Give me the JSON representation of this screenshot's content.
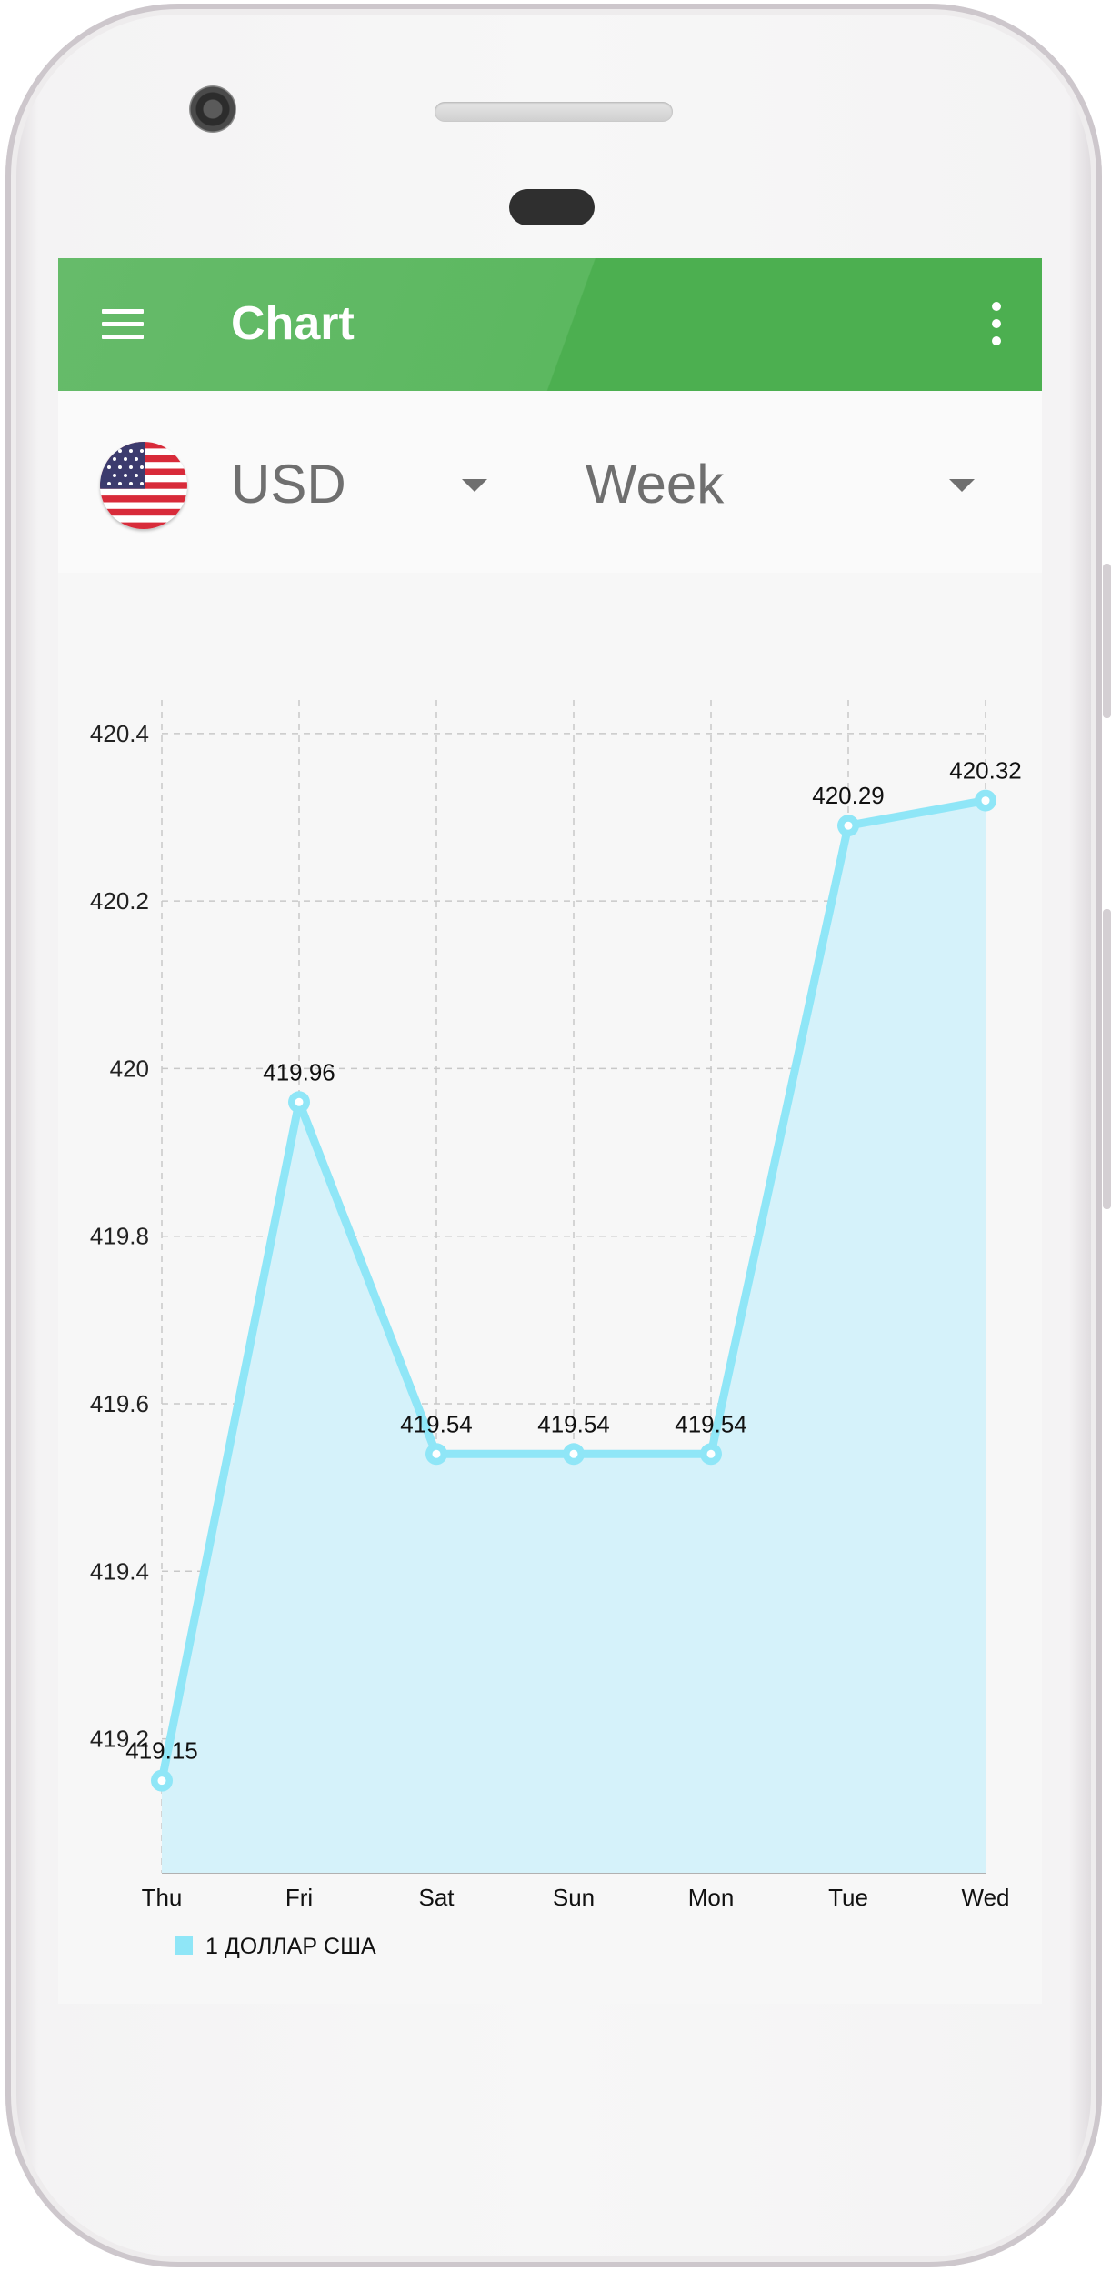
{
  "device": {
    "frame": "phone"
  },
  "app_bar": {
    "title": "Chart",
    "menu_icon": "hamburger-menu-icon",
    "more_icon": "more-vertical-icon",
    "color": "#4caf50"
  },
  "controls": {
    "currency": {
      "flag_icon": "us-flag-icon",
      "value": "USD",
      "arrow_icon": "dropdown-arrow-icon"
    },
    "period": {
      "value": "Week",
      "arrow_icon": "dropdown-arrow-icon"
    }
  },
  "chart_data": {
    "type": "area",
    "categories": [
      "Thu",
      "Fri",
      "Sat",
      "Sun",
      "Mon",
      "Tue",
      "Wed"
    ],
    "series": [
      {
        "name": "1 ДОЛЛАР США",
        "values": [
          419.15,
          419.96,
          419.54,
          419.54,
          419.54,
          420.29,
          420.32
        ],
        "color": "#8fe6f7",
        "fill": "#d5f2fa"
      }
    ],
    "data_labels": [
      "419.15",
      "419.96",
      "419.54",
      "419.54",
      "419.54",
      "420.29",
      "420.32"
    ],
    "y_ticks": [
      "419.2",
      "419.4",
      "419.6",
      "419.8",
      "420",
      "420.2",
      "420.4"
    ],
    "y_tick_values": [
      419.2,
      419.4,
      419.6,
      419.8,
      420.0,
      420.2,
      420.4
    ],
    "ylim": [
      419.04,
      420.44
    ],
    "grid": true,
    "legend": "bottom-left",
    "title": "",
    "xlabel": "",
    "ylabel": ""
  }
}
